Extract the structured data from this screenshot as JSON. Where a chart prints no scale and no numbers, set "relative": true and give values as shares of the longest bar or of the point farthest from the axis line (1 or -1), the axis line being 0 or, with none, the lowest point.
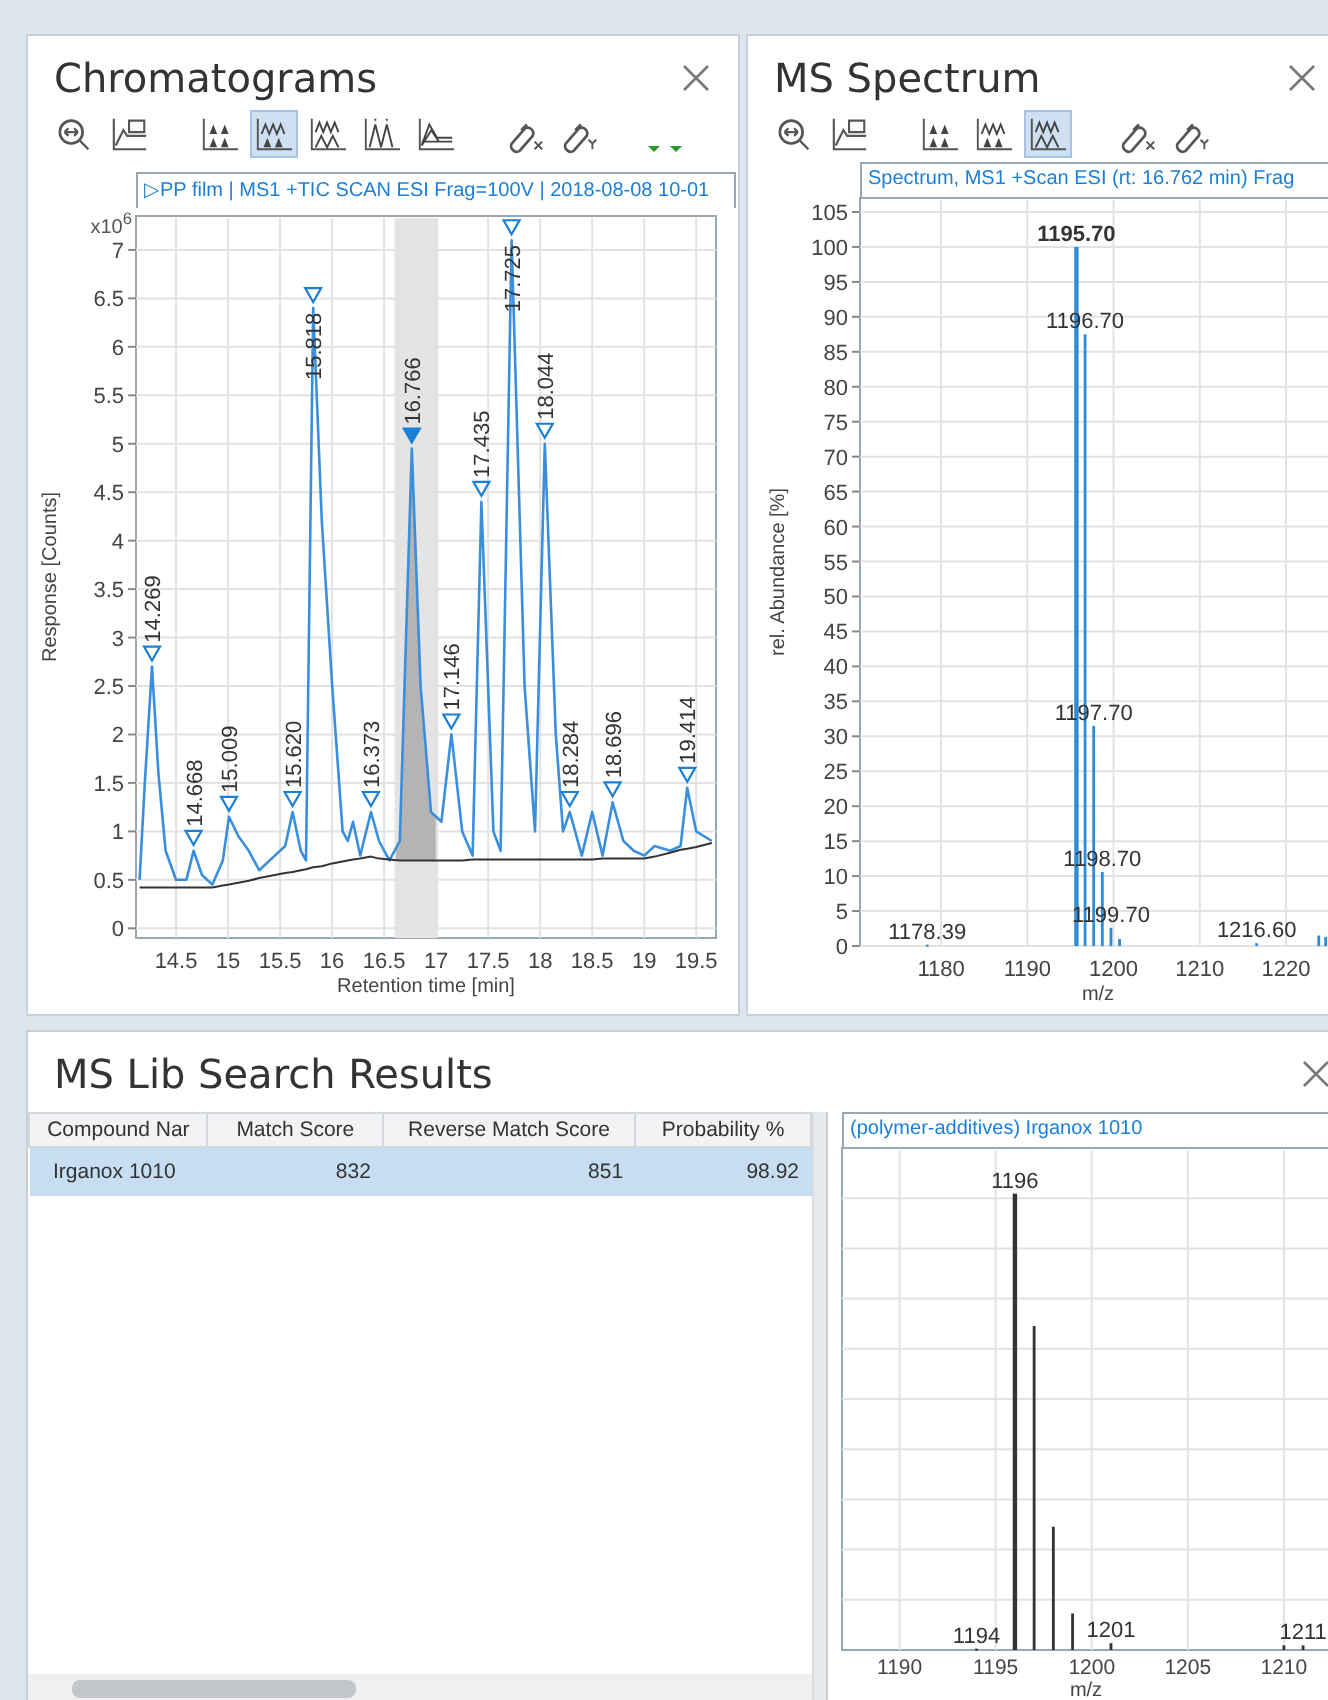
{
  "panels": [
    {
      "kind": "chromatogram",
      "title": "Chromatograms",
      "toolbar": [
        {
          "kind": "zoom",
          "selected": false
        },
        {
          "kind": "axes",
          "selected": false
        },
        {
          "kind": "spacer"
        },
        {
          "kind": "peaks1",
          "selected": false
        },
        {
          "kind": "peaks2",
          "selected": true
        },
        {
          "kind": "peaks3",
          "selected": false
        },
        {
          "kind": "peaks4",
          "selected": false
        },
        {
          "kind": "peaks5",
          "selected": false
        },
        {
          "kind": "spacer"
        },
        {
          "kind": "link-x",
          "selected": false
        },
        {
          "kind": "link-y",
          "selected": false
        },
        {
          "kind": "spacer"
        },
        {
          "kind": "dropdown",
          "selected": false
        },
        {
          "kind": "dropdown",
          "selected": false
        }
      ],
      "scale_label": "x10$^{6}$",
      "peak_markers": [
        {
          "selected": false
        },
        {
          "selected": false
        },
        {
          "selected": false
        },
        {
          "selected": false
        },
        {
          "selected": false
        },
        {
          "selected": false
        },
        {
          "selected": true
        },
        {
          "selected": false
        },
        {
          "selected": false
        },
        {
          "selected": false
        },
        {
          "selected": false
        },
        {
          "selected": false
        },
        {
          "selected": false
        },
        {
          "selected": false
        }
      ],
      "chart_data": {
        "type": "line",
        "title": "▷PP film | MS1 +TIC SCAN ESI Frag=100V | 2018-08-08 10-01",
        "xlabel": "Retention time [min]",
        "ylabel": "Response [Counts]",
        "grid": true,
        "x": [
          14.15,
          14.2,
          14.269,
          14.33,
          14.4,
          14.5,
          14.6,
          14.668,
          14.75,
          14.85,
          14.95,
          15.009,
          15.1,
          15.2,
          15.3,
          15.45,
          15.55,
          15.62,
          15.7,
          15.75,
          15.818,
          15.9,
          16.0,
          16.1,
          16.15,
          16.2,
          16.27,
          16.373,
          16.45,
          16.55,
          16.65,
          16.766,
          16.85,
          16.95,
          17.05,
          17.146,
          17.25,
          17.35,
          17.435,
          17.55,
          17.62,
          17.725,
          17.85,
          17.95,
          18.044,
          18.15,
          18.22,
          18.284,
          18.4,
          18.5,
          18.6,
          18.696,
          18.8,
          18.9,
          19.0,
          19.1,
          19.25,
          19.35,
          19.414,
          19.5,
          19.65
        ],
        "series": [
          {
            "color": "#3a8fdc",
            "values": [
              0.5,
              1.5,
              2.7,
              1.6,
              0.8,
              0.5,
              0.5,
              0.8,
              0.55,
              0.45,
              0.7,
              1.15,
              0.95,
              0.8,
              0.6,
              0.75,
              0.85,
              1.2,
              0.8,
              0.7,
              6.4,
              4.2,
              2.5,
              1.0,
              0.9,
              1.1,
              0.75,
              1.2,
              0.9,
              0.7,
              0.9,
              4.95,
              2.5,
              1.2,
              1.1,
              2.0,
              1.0,
              0.75,
              4.4,
              1.0,
              0.8,
              7.1,
              2.5,
              1.0,
              5.0,
              2.0,
              1.0,
              1.2,
              0.75,
              1.2,
              0.75,
              1.3,
              0.9,
              0.8,
              0.75,
              0.85,
              0.8,
              0.85,
              1.45,
              1.0,
              0.9
            ]
          },
          {
            "color": "#333333",
            "values": [
              0.42,
              0.42,
              0.42,
              0.42,
              0.42,
              0.42,
              0.42,
              0.42,
              0.42,
              0.42,
              0.44,
              0.45,
              0.47,
              0.49,
              0.52,
              0.55,
              0.57,
              0.58,
              0.6,
              0.61,
              0.63,
              0.64,
              0.67,
              0.69,
              0.7,
              0.71,
              0.72,
              0.74,
              0.72,
              0.71,
              0.7,
              0.7,
              0.7,
              0.7,
              0.7,
              0.7,
              0.7,
              0.71,
              0.71,
              0.71,
              0.71,
              0.71,
              0.71,
              0.71,
              0.71,
              0.71,
              0.71,
              0.71,
              0.71,
              0.71,
              0.72,
              0.72,
              0.72,
              0.72,
              0.72,
              0.74,
              0.78,
              0.81,
              0.82,
              0.84,
              0.88
            ]
          }
        ],
        "xlim": [
          14.115,
          19.69
        ],
        "ylim": [
          -0.1,
          7.35
        ],
        "bands": [
          {
            "axis": "x",
            "from": 16.6,
            "to": 17.02
          }
        ],
        "xticks": [
          14.5,
          15,
          15.5,
          16,
          16.5,
          17,
          17.5,
          18,
          18.5,
          19,
          19.5
        ],
        "yticks": [
          0,
          0.5,
          1,
          1.5,
          2,
          2.5,
          3,
          3.5,
          4,
          4.5,
          5,
          5.5,
          6,
          6.5,
          7
        ],
        "annotations": [
          {
            "x": 14.269,
            "y": 2.7,
            "text": "14.269"
          },
          {
            "x": 14.668,
            "y": 0.8,
            "text": "14.668"
          },
          {
            "x": 15.009,
            "y": 1.15,
            "text": "15.009"
          },
          {
            "x": 15.62,
            "y": 1.2,
            "text": "15.620"
          },
          {
            "x": 15.818,
            "y": 6.4,
            "text": "15.818"
          },
          {
            "x": 16.373,
            "y": 1.2,
            "text": "16.373"
          },
          {
            "x": 16.766,
            "y": 4.95,
            "text": "16.766"
          },
          {
            "x": 17.146,
            "y": 2.0,
            "text": "17.146"
          },
          {
            "x": 17.435,
            "y": 4.4,
            "text": "17.435"
          },
          {
            "x": 17.725,
            "y": 7.1,
            "text": "17.725"
          },
          {
            "x": 18.044,
            "y": 5.0,
            "text": "18.044"
          },
          {
            "x": 18.284,
            "y": 1.2,
            "text": "18.284"
          },
          {
            "x": 18.696,
            "y": 1.3,
            "text": "18.696"
          },
          {
            "x": 19.414,
            "y": 1.45,
            "text": "19.414"
          }
        ]
      }
    },
    {
      "kind": "spectrum",
      "title": "MS Spectrum",
      "toolbar": [
        {
          "kind": "zoom",
          "selected": false
        },
        {
          "kind": "axes",
          "selected": false
        },
        {
          "kind": "spacer"
        },
        {
          "kind": "peaks1",
          "selected": false
        },
        {
          "kind": "peaks2",
          "selected": false
        },
        {
          "kind": "peaks3",
          "selected": true
        },
        {
          "kind": "spacer"
        },
        {
          "kind": "link-x",
          "selected": false
        },
        {
          "kind": "link-y",
          "selected": false
        }
      ],
      "chart_data": {
        "type": "bar",
        "title": "Spectrum, MS1 +Scan ESI (rt: 16.762 min) Frag",
        "xlabel": "m/z",
        "ylabel": "rel. Abundance [%]",
        "grid": true,
        "x": [
          1178.39,
          1195.7,
          1196.7,
          1197.7,
          1198.7,
          1199.7,
          1200.7,
          1216.6,
          1223.8,
          1224.6
        ],
        "series": [
          {
            "color": "#2f8ad8",
            "values": [
              0.2,
              100,
              87.5,
              31.5,
              10.6,
              2.6,
              1,
              0.4,
              1.5,
              1.3
            ]
          }
        ],
        "xlim": [
          1170.6,
          1225.8
        ],
        "ylim": [
          0,
          107
        ],
        "xticks": [
          1180,
          1190,
          1200,
          1210,
          1220
        ],
        "yticks": [
          0,
          5,
          10,
          15,
          20,
          25,
          30,
          35,
          40,
          45,
          50,
          55,
          60,
          65,
          70,
          75,
          80,
          85,
          90,
          95,
          100,
          105
        ],
        "annotations": [
          {
            "x": 1195.7,
            "y": 100,
            "text": "1195.70"
          },
          {
            "x": 1196.7,
            "y": 87.5,
            "text": "1196.70"
          },
          {
            "x": 1197.7,
            "y": 31.5,
            "text": "1197.70"
          },
          {
            "x": 1198.7,
            "y": 10.6,
            "text": "1198.70"
          },
          {
            "x": 1199.7,
            "y": 2.6,
            "text": "1199.70"
          },
          {
            "x": 1178.39,
            "y": 0.2,
            "text": "1178.39"
          },
          {
            "x": 1216.6,
            "y": 0.4,
            "text": "1216.60"
          }
        ]
      }
    }
  ],
  "lib_search": {
    "title": "MS Lib Search Results",
    "table": {
      "columns": [
        "Compound Nar",
        "Match Score",
        "Reverse Match Score",
        "Probability %"
      ],
      "rows": [
        {
          "cells": [
            "Irganox 1010",
            "832",
            "851",
            "98.92"
          ],
          "selected": true
        }
      ]
    },
    "chart_data": {
      "type": "bar",
      "title": "(polymer-additives) Irganox 1010",
      "xlabel": "m/z",
      "grid": true,
      "relative": true,
      "x": [
        1194,
        1196,
        1197,
        1198,
        1199,
        1201,
        1210,
        1211
      ],
      "series": [
        {
          "color": "#333333",
          "values": [
            0.003,
            1,
            0.71,
            0.27,
            0.08,
            0.015,
            0.01,
            0.01
          ]
        }
      ],
      "xlim": [
        1187,
        1212.4
      ],
      "xticks": [
        1190,
        1195,
        1200,
        1205,
        1210
      ],
      "annotations": [
        {
          "x": 1196,
          "y": 1,
          "text": "1196"
        },
        {
          "x": 1194,
          "y": 0.003,
          "text": "1194"
        },
        {
          "x": 1201,
          "y": 0.015,
          "text": "1201"
        },
        {
          "x": 1211,
          "y": 0.01,
          "text": "1211"
        }
      ]
    }
  }
}
